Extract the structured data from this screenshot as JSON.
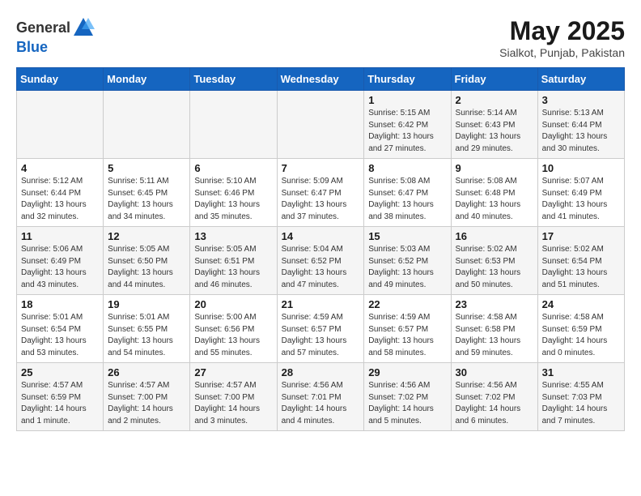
{
  "header": {
    "logo_general": "General",
    "logo_blue": "Blue",
    "title": "May 2025",
    "location": "Sialkot, Punjab, Pakistan"
  },
  "columns": [
    "Sunday",
    "Monday",
    "Tuesday",
    "Wednesday",
    "Thursday",
    "Friday",
    "Saturday"
  ],
  "weeks": [
    [
      {
        "day": "",
        "info": ""
      },
      {
        "day": "",
        "info": ""
      },
      {
        "day": "",
        "info": ""
      },
      {
        "day": "",
        "info": ""
      },
      {
        "day": "1",
        "info": "Sunrise: 5:15 AM\nSunset: 6:42 PM\nDaylight: 13 hours\nand 27 minutes."
      },
      {
        "day": "2",
        "info": "Sunrise: 5:14 AM\nSunset: 6:43 PM\nDaylight: 13 hours\nand 29 minutes."
      },
      {
        "day": "3",
        "info": "Sunrise: 5:13 AM\nSunset: 6:44 PM\nDaylight: 13 hours\nand 30 minutes."
      }
    ],
    [
      {
        "day": "4",
        "info": "Sunrise: 5:12 AM\nSunset: 6:44 PM\nDaylight: 13 hours\nand 32 minutes."
      },
      {
        "day": "5",
        "info": "Sunrise: 5:11 AM\nSunset: 6:45 PM\nDaylight: 13 hours\nand 34 minutes."
      },
      {
        "day": "6",
        "info": "Sunrise: 5:10 AM\nSunset: 6:46 PM\nDaylight: 13 hours\nand 35 minutes."
      },
      {
        "day": "7",
        "info": "Sunrise: 5:09 AM\nSunset: 6:47 PM\nDaylight: 13 hours\nand 37 minutes."
      },
      {
        "day": "8",
        "info": "Sunrise: 5:08 AM\nSunset: 6:47 PM\nDaylight: 13 hours\nand 38 minutes."
      },
      {
        "day": "9",
        "info": "Sunrise: 5:08 AM\nSunset: 6:48 PM\nDaylight: 13 hours\nand 40 minutes."
      },
      {
        "day": "10",
        "info": "Sunrise: 5:07 AM\nSunset: 6:49 PM\nDaylight: 13 hours\nand 41 minutes."
      }
    ],
    [
      {
        "day": "11",
        "info": "Sunrise: 5:06 AM\nSunset: 6:49 PM\nDaylight: 13 hours\nand 43 minutes."
      },
      {
        "day": "12",
        "info": "Sunrise: 5:05 AM\nSunset: 6:50 PM\nDaylight: 13 hours\nand 44 minutes."
      },
      {
        "day": "13",
        "info": "Sunrise: 5:05 AM\nSunset: 6:51 PM\nDaylight: 13 hours\nand 46 minutes."
      },
      {
        "day": "14",
        "info": "Sunrise: 5:04 AM\nSunset: 6:52 PM\nDaylight: 13 hours\nand 47 minutes."
      },
      {
        "day": "15",
        "info": "Sunrise: 5:03 AM\nSunset: 6:52 PM\nDaylight: 13 hours\nand 49 minutes."
      },
      {
        "day": "16",
        "info": "Sunrise: 5:02 AM\nSunset: 6:53 PM\nDaylight: 13 hours\nand 50 minutes."
      },
      {
        "day": "17",
        "info": "Sunrise: 5:02 AM\nSunset: 6:54 PM\nDaylight: 13 hours\nand 51 minutes."
      }
    ],
    [
      {
        "day": "18",
        "info": "Sunrise: 5:01 AM\nSunset: 6:54 PM\nDaylight: 13 hours\nand 53 minutes."
      },
      {
        "day": "19",
        "info": "Sunrise: 5:01 AM\nSunset: 6:55 PM\nDaylight: 13 hours\nand 54 minutes."
      },
      {
        "day": "20",
        "info": "Sunrise: 5:00 AM\nSunset: 6:56 PM\nDaylight: 13 hours\nand 55 minutes."
      },
      {
        "day": "21",
        "info": "Sunrise: 4:59 AM\nSunset: 6:57 PM\nDaylight: 13 hours\nand 57 minutes."
      },
      {
        "day": "22",
        "info": "Sunrise: 4:59 AM\nSunset: 6:57 PM\nDaylight: 13 hours\nand 58 minutes."
      },
      {
        "day": "23",
        "info": "Sunrise: 4:58 AM\nSunset: 6:58 PM\nDaylight: 13 hours\nand 59 minutes."
      },
      {
        "day": "24",
        "info": "Sunrise: 4:58 AM\nSunset: 6:59 PM\nDaylight: 14 hours\nand 0 minutes."
      }
    ],
    [
      {
        "day": "25",
        "info": "Sunrise: 4:57 AM\nSunset: 6:59 PM\nDaylight: 14 hours\nand 1 minute."
      },
      {
        "day": "26",
        "info": "Sunrise: 4:57 AM\nSunset: 7:00 PM\nDaylight: 14 hours\nand 2 minutes."
      },
      {
        "day": "27",
        "info": "Sunrise: 4:57 AM\nSunset: 7:00 PM\nDaylight: 14 hours\nand 3 minutes."
      },
      {
        "day": "28",
        "info": "Sunrise: 4:56 AM\nSunset: 7:01 PM\nDaylight: 14 hours\nand 4 minutes."
      },
      {
        "day": "29",
        "info": "Sunrise: 4:56 AM\nSunset: 7:02 PM\nDaylight: 14 hours\nand 5 minutes."
      },
      {
        "day": "30",
        "info": "Sunrise: 4:56 AM\nSunset: 7:02 PM\nDaylight: 14 hours\nand 6 minutes."
      },
      {
        "day": "31",
        "info": "Sunrise: 4:55 AM\nSunset: 7:03 PM\nDaylight: 14 hours\nand 7 minutes."
      }
    ]
  ]
}
